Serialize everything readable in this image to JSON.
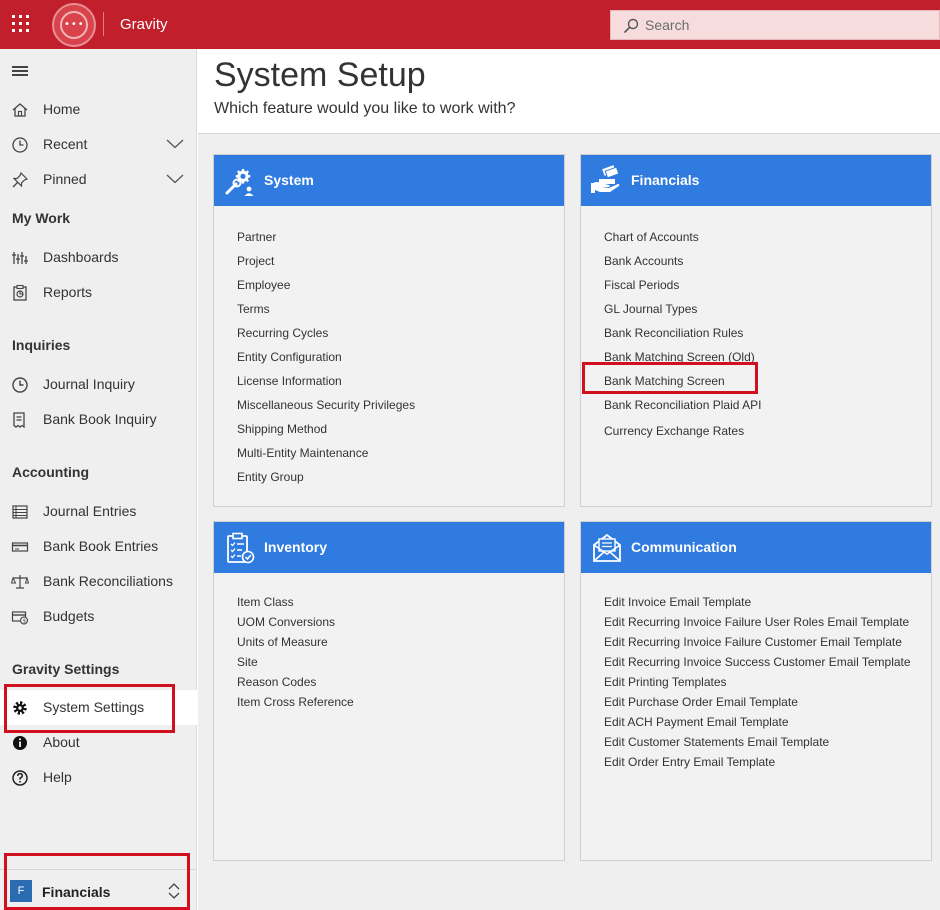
{
  "app": {
    "title": "Gravity"
  },
  "search": {
    "placeholder": "Search"
  },
  "sidebar": {
    "items": [
      {
        "label": "Home",
        "icon": "home-icon"
      },
      {
        "label": "Recent",
        "icon": "clock-icon"
      },
      {
        "label": "Pinned",
        "icon": "pin-icon"
      }
    ],
    "sections": [
      {
        "title": "My Work",
        "items": [
          {
            "label": "Dashboards",
            "icon": "dashboard-icon"
          },
          {
            "label": "Reports",
            "icon": "reports-icon"
          }
        ]
      },
      {
        "title": "Inquiries",
        "items": [
          {
            "label": "Journal Inquiry",
            "icon": "journal-inquiry-icon"
          },
          {
            "label": "Bank Book Inquiry",
            "icon": "bank-book-inquiry-icon"
          }
        ]
      },
      {
        "title": "Accounting",
        "items": [
          {
            "label": "Journal Entries",
            "icon": "journal-entries-icon"
          },
          {
            "label": "Bank Book Entries",
            "icon": "bank-book-entries-icon"
          },
          {
            "label": "Bank Reconciliations",
            "icon": "scale-icon"
          },
          {
            "label": "Budgets",
            "icon": "budgets-icon"
          }
        ]
      },
      {
        "title": "Gravity Settings",
        "items": [
          {
            "label": "System Settings",
            "icon": "gear-icon"
          },
          {
            "label": "About",
            "icon": "info-icon"
          },
          {
            "label": "Help",
            "icon": "help-icon"
          }
        ]
      }
    ],
    "area": {
      "badge": "F",
      "label": "Financials"
    }
  },
  "page": {
    "title": "System Setup",
    "subtitle": "Which feature would you like to work with?"
  },
  "cards": [
    {
      "title": "System",
      "icon": "system-tools-icon",
      "items": [
        "Partner",
        "Project",
        "Employee",
        "Terms",
        "Recurring Cycles",
        "Entity Configuration",
        "License Information",
        "Miscellaneous Security Privileges",
        "Shipping Method",
        "Multi-Entity Maintenance",
        "Entity Group"
      ]
    },
    {
      "title": "Financials",
      "icon": "money-hand-icon",
      "items": [
        "Chart of Accounts",
        "Bank Accounts",
        "Fiscal Periods",
        "GL Journal Types",
        "Bank Reconciliation Rules",
        "Bank Matching Screen (Old)",
        "Bank Matching Screen",
        "Bank Reconciliation Plaid API",
        "Currency Exchange Rates"
      ]
    },
    {
      "title": "Inventory",
      "icon": "clipboard-check-icon",
      "items": [
        "Item Class",
        "UOM Conversions",
        "Units of Measure",
        "Site",
        "Reason Codes",
        "Item Cross Reference"
      ]
    },
    {
      "title": "Communication",
      "icon": "envelope-icon",
      "items": [
        "Edit Invoice Email Template",
        "Edit Recurring Invoice Failure User Roles Email Template",
        "Edit Recurring Invoice Failure Customer Email Template",
        "Edit Recurring Invoice Success Customer Email Template",
        "Edit Printing Templates",
        "Edit Purchase Order Email Template",
        "Edit ACH Payment Email Template",
        "Edit Customer Statements Email Template",
        "Edit Order Entry Email Template"
      ]
    }
  ],
  "colors": {
    "topbar": "#c01f2b",
    "card_header": "#2f7be0",
    "highlight": "#d0101e"
  }
}
